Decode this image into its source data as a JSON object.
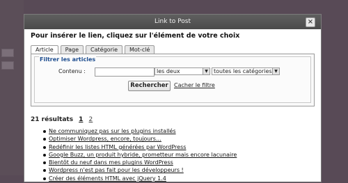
{
  "dialog": {
    "title": "Link to Post",
    "close_glyph": "×",
    "heading": "Pour insérer le lien, cliquez sur l'élément de votre choix"
  },
  "tabs": [
    {
      "label": "Article",
      "active": true
    },
    {
      "label": "Page",
      "active": false
    },
    {
      "label": "Catégorie",
      "active": false
    },
    {
      "label": "Mot-clé",
      "active": false
    }
  ],
  "filter": {
    "legend": "Filtrer les articles",
    "content_label": "Contenu :",
    "content_value": "",
    "select_1_value": "les deux",
    "select_2_value": "toutes les catégories",
    "search_button": "Rechercher",
    "clear_link": "Cacher le filtre"
  },
  "results": {
    "count_label": "21 résultats",
    "pages": [
      "1",
      "2"
    ],
    "current_page": "1"
  },
  "articles": [
    "Ne communiquez pas sur les plugins installés",
    "Optimiser Wordpress, encore, toujours…",
    "Redéfinir les listes HTML générées par WordPress",
    "Google Buzz, un produit hybride, prometteur mais encore lacunaire",
    "Bientôt du neuf dans mes plugins WordPress",
    "Wordpress n'est pas fait pour les développeurs !",
    "Créer des éléments HTML avec jQuery 1.4"
  ],
  "icons": {
    "dropdown": "chevron-down-icon",
    "bullet": "bullet-icon",
    "close": "close-icon"
  },
  "colors": {
    "overlay": "#584a56",
    "titlebar": "#4b4b4b",
    "legend": "#1d4d8f"
  }
}
